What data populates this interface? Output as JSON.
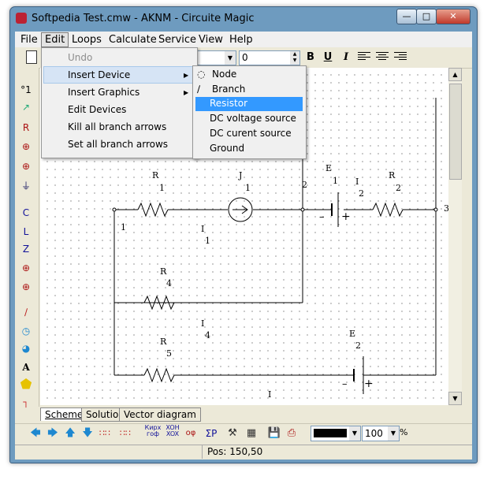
{
  "window": {
    "title": "Softpedia Test.cmw - AKNM - Circuite Magic"
  },
  "menubar": [
    "File",
    "Edit",
    "Loops",
    "Calculate",
    "Service",
    "View",
    "Help"
  ],
  "edit_menu": {
    "items": [
      "Undo",
      "Insert Device",
      "Insert Graphics",
      "Edit Devices",
      "Kill all branch arrows",
      "Set all branch arrows"
    ],
    "disabled": [
      "Undo"
    ],
    "highlighted": "Insert Device"
  },
  "insert_device_menu": {
    "items": [
      "Node",
      "Branch",
      "Resistor",
      "DC voltage source",
      "DC curent source",
      "Ground"
    ],
    "selected": "Resistor"
  },
  "toolbar": {
    "font_size_value": "0",
    "format_buttons": [
      "B",
      "U",
      "I"
    ]
  },
  "circuit": {
    "nodes": [
      "1",
      "2",
      "3"
    ],
    "labels": {
      "r1": "R",
      "r1_sub": "1",
      "j1": "J",
      "j1_sub": "1",
      "e1": "E",
      "e1_sub": "1",
      "i2": "I",
      "i2_sub": "2",
      "r2": "R",
      "r2_sub": "2",
      "i1": "I",
      "i1_sub": "1",
      "r4": "R",
      "r4_sub": "4",
      "i4": "I",
      "i4_sub": "4",
      "r5": "R",
      "r5_sub": "5",
      "e2": "E",
      "e2_sub": "2",
      "i_bottom": "I",
      "minus": "–",
      "plus": "+"
    }
  },
  "tabs": [
    "Scheme",
    "Solution",
    "Vector diagram"
  ],
  "bottom_toolbar": {
    "zoom_value": "100",
    "zoom_unit": "%",
    "kirchhoff_label": "Кирх\nгоф",
    "xoh_label": "XOH\nXOX",
    "phi_label": "oφ",
    "sum_label": "ΣP",
    "line_color": "#000000"
  },
  "status": {
    "position": "Pos: 150,50"
  },
  "colors": {
    "titlebar": "#6e9bbf",
    "menu_highlight": "#3399ff",
    "icon_accent": "#1e88d0"
  }
}
